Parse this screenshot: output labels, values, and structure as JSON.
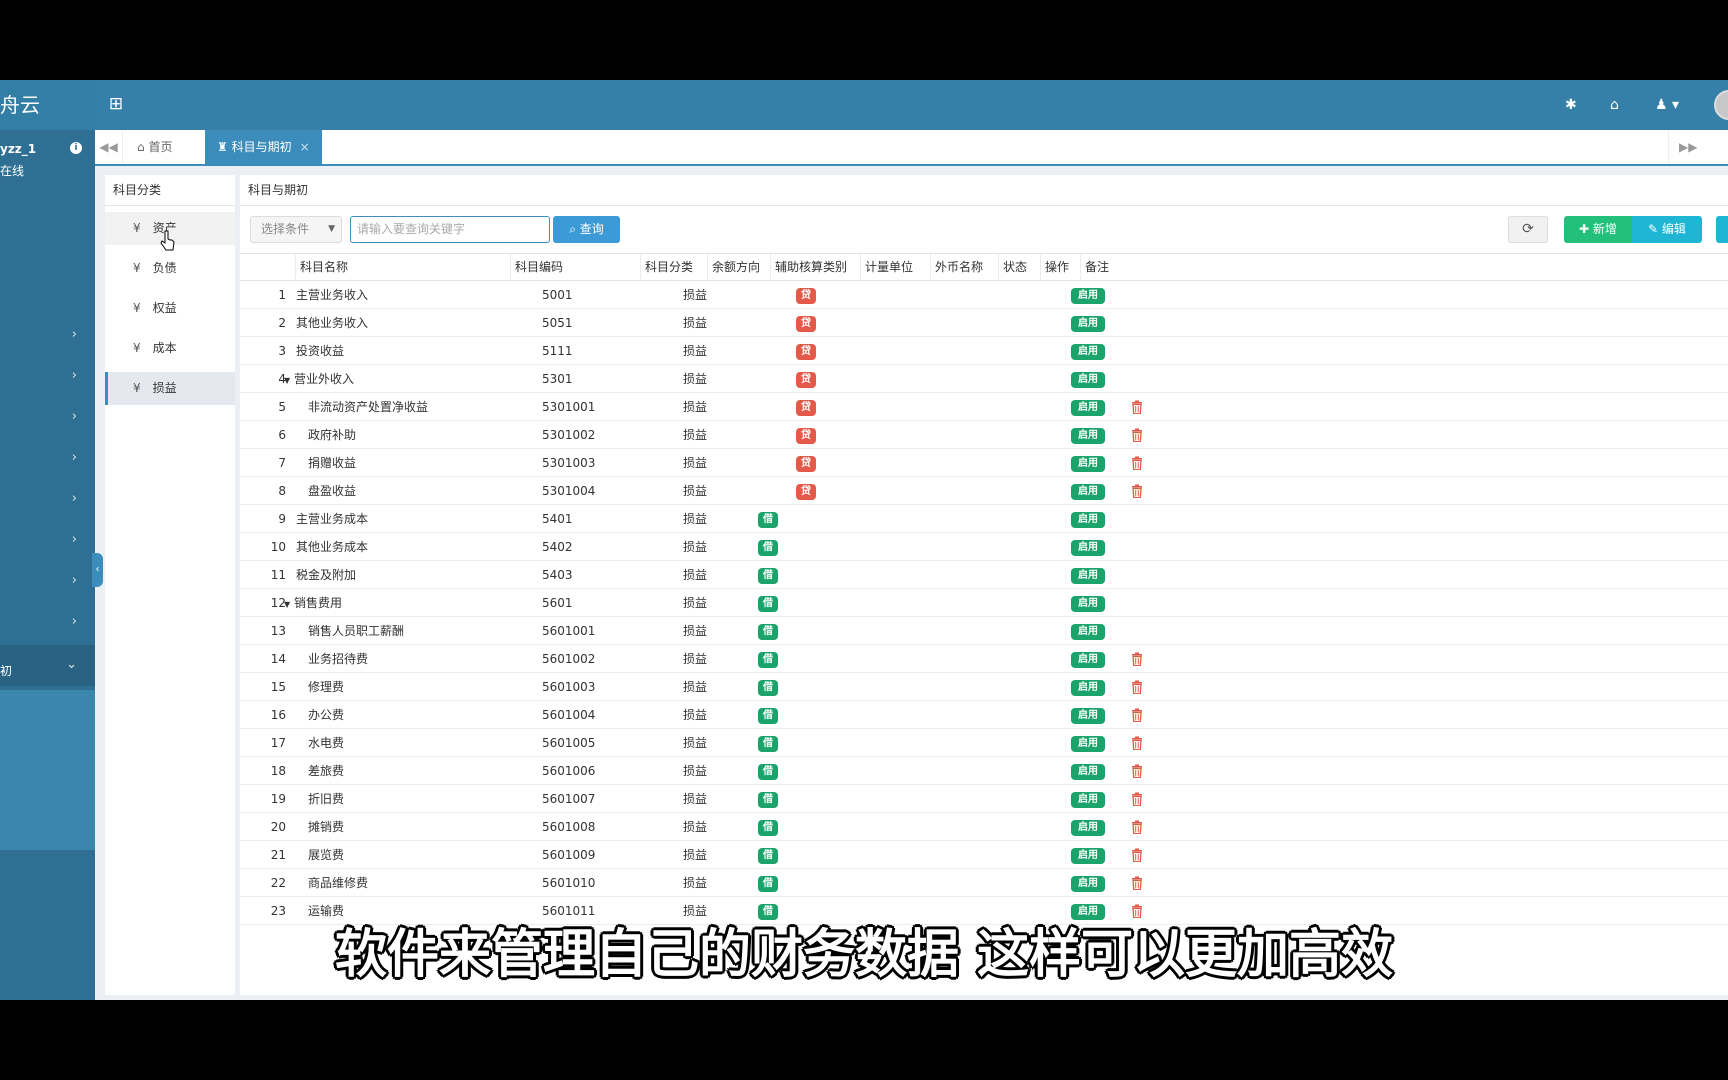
{
  "app": {
    "logo_text": "舟云",
    "user_name": "yzz_1",
    "user_status": "在线",
    "sidebar_sub_label": "初"
  },
  "colors": {
    "header": "#367fa9",
    "accent": "#3c8dbc",
    "credit": "#e35a4b",
    "debit": "#1aa36b",
    "add": "#22c07a",
    "edit": "#1fb6d4"
  },
  "tabs": {
    "home": "首页",
    "active": "科目与期初",
    "close": "×"
  },
  "category_panel": {
    "title": "科目分类",
    "items": [
      {
        "icon": "yen-icon",
        "label": "资产"
      },
      {
        "icon": "yen-icon",
        "label": "负债"
      },
      {
        "icon": "yen-icon",
        "label": "权益"
      },
      {
        "icon": "yen-icon",
        "label": "成本"
      },
      {
        "icon": "yen-icon",
        "label": "损益"
      }
    ],
    "selected": "损益"
  },
  "main": {
    "title": "科目与期初",
    "select_placeholder": "选择条件",
    "search_placeholder": "请输入要查询关键字",
    "query_label": "查询",
    "add_label": "新增",
    "edit_label": "编辑"
  },
  "table": {
    "headers": [
      "科目名称",
      "科目编码",
      "科目分类",
      "余额方向",
      "辅助核算类别",
      "计量单位",
      "外币名称",
      "状态",
      "操作",
      "备注"
    ],
    "credit_label": "贷",
    "debit_label": "借",
    "status_label": "启用",
    "rows": [
      {
        "idx": "1",
        "name": "主营业务收入",
        "code": "5001",
        "cat": "损益",
        "dir": "credit",
        "level": 0,
        "expand": false,
        "del": false
      },
      {
        "idx": "2",
        "name": "其他业务收入",
        "code": "5051",
        "cat": "损益",
        "dir": "credit",
        "level": 0,
        "expand": false,
        "del": false
      },
      {
        "idx": "3",
        "name": "投资收益",
        "code": "5111",
        "cat": "损益",
        "dir": "credit",
        "level": 0,
        "expand": false,
        "del": false
      },
      {
        "idx": "4",
        "name": "营业外收入",
        "code": "5301",
        "cat": "损益",
        "dir": "credit",
        "level": 0,
        "expand": true,
        "del": false
      },
      {
        "idx": "5",
        "name": "非流动资产处置净收益",
        "code": "5301001",
        "cat": "损益",
        "dir": "credit",
        "level": 1,
        "expand": false,
        "del": true
      },
      {
        "idx": "6",
        "name": "政府补助",
        "code": "5301002",
        "cat": "损益",
        "dir": "credit",
        "level": 1,
        "expand": false,
        "del": true
      },
      {
        "idx": "7",
        "name": "捐赠收益",
        "code": "5301003",
        "cat": "损益",
        "dir": "credit",
        "level": 1,
        "expand": false,
        "del": true
      },
      {
        "idx": "8",
        "name": "盘盈收益",
        "code": "5301004",
        "cat": "损益",
        "dir": "credit",
        "level": 1,
        "expand": false,
        "del": true
      },
      {
        "idx": "9",
        "name": "主营业务成本",
        "code": "5401",
        "cat": "损益",
        "dir": "debit",
        "level": 0,
        "expand": false,
        "del": false
      },
      {
        "idx": "10",
        "name": "其他业务成本",
        "code": "5402",
        "cat": "损益",
        "dir": "debit",
        "level": 0,
        "expand": false,
        "del": false
      },
      {
        "idx": "11",
        "name": "税金及附加",
        "code": "5403",
        "cat": "损益",
        "dir": "debit",
        "level": 0,
        "expand": false,
        "del": false
      },
      {
        "idx": "12",
        "name": "销售费用",
        "code": "5601",
        "cat": "损益",
        "dir": "debit",
        "level": 0,
        "expand": true,
        "del": false
      },
      {
        "idx": "13",
        "name": "销售人员职工薪酬",
        "code": "5601001",
        "cat": "损益",
        "dir": "debit",
        "level": 1,
        "expand": false,
        "del": false
      },
      {
        "idx": "14",
        "name": "业务招待费",
        "code": "5601002",
        "cat": "损益",
        "dir": "debit",
        "level": 1,
        "expand": false,
        "del": true
      },
      {
        "idx": "15",
        "name": "修理费",
        "code": "5601003",
        "cat": "损益",
        "dir": "debit",
        "level": 1,
        "expand": false,
        "del": true
      },
      {
        "idx": "16",
        "name": "办公费",
        "code": "5601004",
        "cat": "损益",
        "dir": "debit",
        "level": 1,
        "expand": false,
        "del": true
      },
      {
        "idx": "17",
        "name": "水电费",
        "code": "5601005",
        "cat": "损益",
        "dir": "debit",
        "level": 1,
        "expand": false,
        "del": true
      },
      {
        "idx": "18",
        "name": "差旅费",
        "code": "5601006",
        "cat": "损益",
        "dir": "debit",
        "level": 1,
        "expand": false,
        "del": true
      },
      {
        "idx": "19",
        "name": "折旧费",
        "code": "5601007",
        "cat": "损益",
        "dir": "debit",
        "level": 1,
        "expand": false,
        "del": true
      },
      {
        "idx": "20",
        "name": "摊销费",
        "code": "5601008",
        "cat": "损益",
        "dir": "debit",
        "level": 1,
        "expand": false,
        "del": true
      },
      {
        "idx": "21",
        "name": "展览费",
        "code": "5601009",
        "cat": "损益",
        "dir": "debit",
        "level": 1,
        "expand": false,
        "del": true
      },
      {
        "idx": "22",
        "name": "商品维修费",
        "code": "5601010",
        "cat": "损益",
        "dir": "debit",
        "level": 1,
        "expand": false,
        "del": true
      },
      {
        "idx": "23",
        "name": "运输费",
        "code": "5601011",
        "cat": "损益",
        "dir": "debit",
        "level": 1,
        "expand": false,
        "del": true
      }
    ]
  },
  "subtitle": "软件来管理自己的财务数据 这样可以更加高效"
}
